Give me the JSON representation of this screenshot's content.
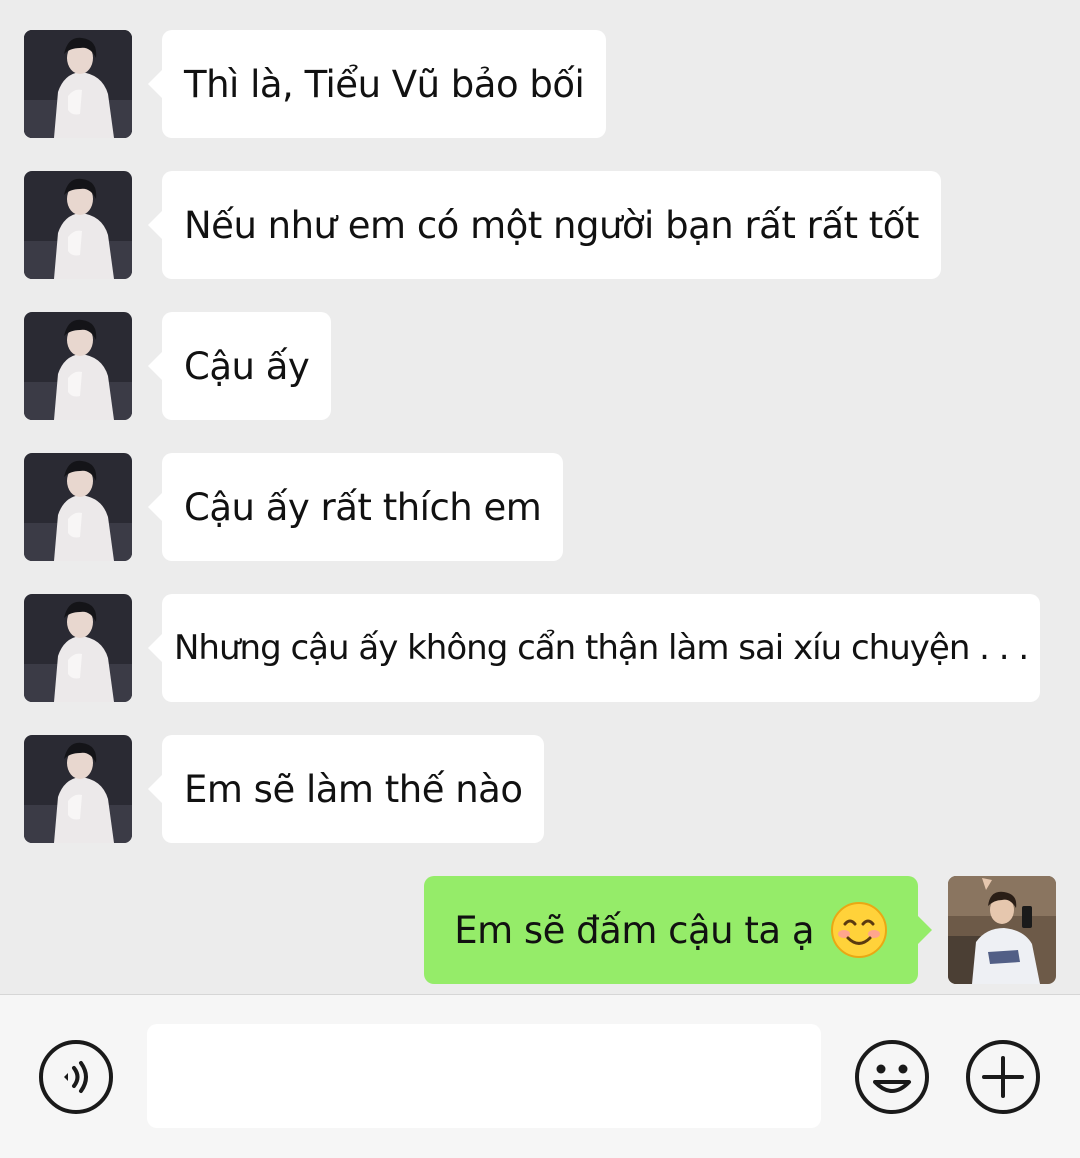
{
  "messages": [
    {
      "side": "in",
      "text": "Thì là, Tiểu Vũ bảo bối",
      "avatar": "contact-avatar"
    },
    {
      "side": "in",
      "text": "Nếu như em có một người bạn rất rất tốt",
      "avatar": "contact-avatar"
    },
    {
      "side": "in",
      "text": "Cậu ấy",
      "avatar": "contact-avatar"
    },
    {
      "side": "in",
      "text": "Cậu ấy rất thích em",
      "avatar": "contact-avatar"
    },
    {
      "side": "in",
      "text": "Nhưng cậu ấy không cẩn thận làm sai xíu chuyện . . .",
      "avatar": "contact-avatar"
    },
    {
      "side": "in",
      "text": "Em sẽ làm thế nào",
      "avatar": "contact-avatar"
    },
    {
      "side": "out",
      "text": "Em sẽ đấm cậu ta ạ",
      "emoji": "smiling-face-icon",
      "avatar": "my-avatar"
    }
  ],
  "input": {
    "value": "",
    "placeholder": ""
  },
  "icons": {
    "voice": "voice-input-icon",
    "emoji": "emoji-icon",
    "plus": "plus-icon"
  },
  "colors": {
    "background": "#ececec",
    "incoming_bubble": "#ffffff",
    "outgoing_bubble": "#95ec69",
    "input_bar": "#f6f6f6"
  }
}
